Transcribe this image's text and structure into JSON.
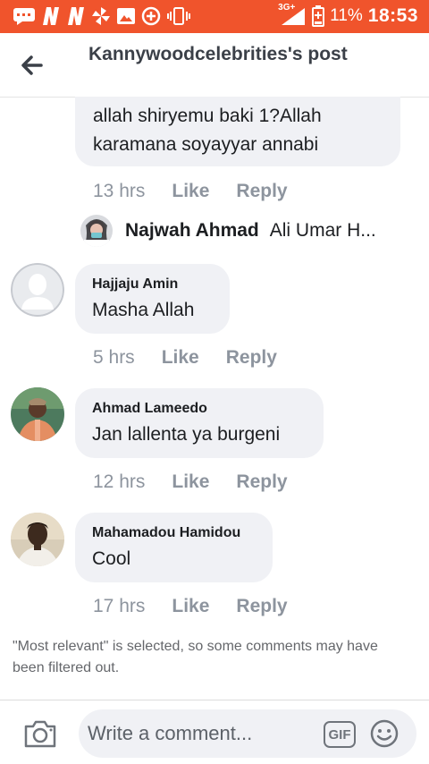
{
  "status_bar": {
    "network": "3G+",
    "battery": "11%",
    "time": "18:53",
    "icons": [
      "message-icon",
      "n-icon",
      "n-icon",
      "pinwheel-icon",
      "gallery-icon",
      "data-saver-icon",
      "vibrate-icon",
      "signal-icon",
      "battery-charging-icon"
    ]
  },
  "header": {
    "title": "Kannywoodcelebrities's post",
    "back_icon": "back-arrow-icon"
  },
  "comments": [
    {
      "text": "allah shiryemu baki 1?Allah karamana soyayyar annabi",
      "time": "13 hrs",
      "like": "Like",
      "reply": "Reply"
    },
    {
      "name": "Hajjaju Amin",
      "text": "Masha Allah",
      "time": "5 hrs",
      "like": "Like",
      "reply": "Reply"
    },
    {
      "name": "Ahmad Lameedo",
      "text": "Jan lallenta ya burgeni",
      "time": "12 hrs",
      "like": "Like",
      "reply": "Reply"
    },
    {
      "name": "Mahamadou Hamidou",
      "text": "Cool",
      "time": "17 hrs",
      "like": "Like",
      "reply": "Reply"
    }
  ],
  "reply_preview": {
    "name": "Najwah Ahmad",
    "text": "Ali Umar H..."
  },
  "notice": "\"Most relevant\" is selected, so some comments may have been filtered out.",
  "composer": {
    "placeholder": "Write a comment...",
    "gif_label": "GIF",
    "camera_icon": "camera-icon",
    "emoji_icon": "emoji-icon"
  },
  "colors": {
    "status_bar": "#f0542c",
    "bubble": "#f0f1f5",
    "meta_text": "#8d949e"
  }
}
